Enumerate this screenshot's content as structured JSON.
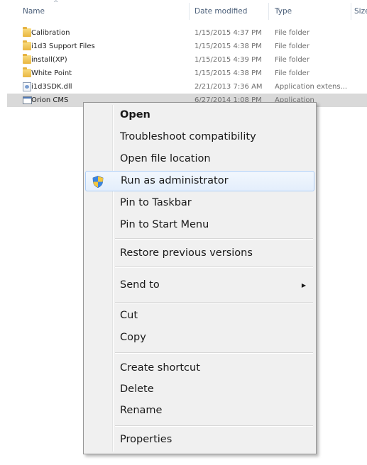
{
  "columns": {
    "name": "Name",
    "date_modified": "Date modified",
    "type": "Type",
    "size": "Size"
  },
  "files": [
    {
      "name": "Calibration",
      "date": "1/15/2015 4:37 PM",
      "type": "File folder",
      "icon": "folder-icon"
    },
    {
      "name": "i1d3 Support Files",
      "date": "1/15/2015 4:38 PM",
      "type": "File folder",
      "icon": "folder-icon"
    },
    {
      "name": "install(XP)",
      "date": "1/15/2015 4:39 PM",
      "type": "File folder",
      "icon": "folder-icon"
    },
    {
      "name": "White Point",
      "date": "1/15/2015 4:38 PM",
      "type": "File folder",
      "icon": "folder-icon"
    },
    {
      "name": "i1d3SDK.dll",
      "date": "2/21/2013 7:36 AM",
      "type": "Application extens...",
      "icon": "dll-icon"
    },
    {
      "name": "Orion CMS",
      "date": "6/27/2014 1:08 PM",
      "type": "Application",
      "icon": "app-icon"
    }
  ],
  "context_menu": {
    "open": "Open",
    "troubleshoot": "Troubleshoot compatibility",
    "open_location": "Open file location",
    "run_admin": "Run as administrator",
    "pin_taskbar": "Pin to Taskbar",
    "pin_start": "Pin to Start Menu",
    "restore": "Restore previous versions",
    "send_to": "Send to",
    "cut": "Cut",
    "copy": "Copy",
    "create_shortcut": "Create shortcut",
    "delete": "Delete",
    "rename": "Rename",
    "properties": "Properties"
  },
  "colors": {
    "selected_row": "#d9d9d9",
    "menu_background": "#f0f0f0",
    "hover_border": "#aecff7"
  }
}
